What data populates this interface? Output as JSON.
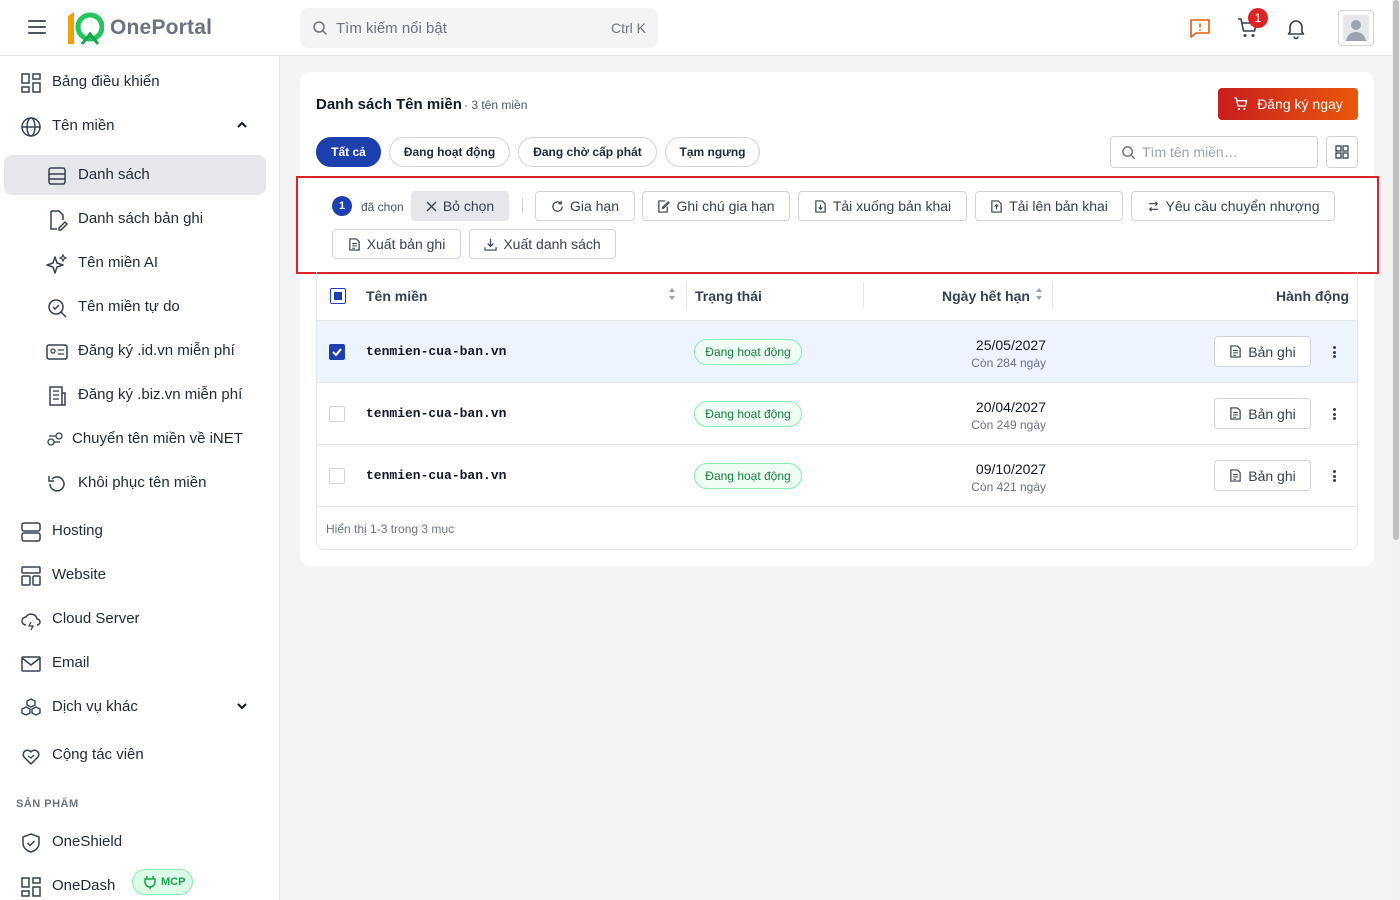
{
  "header": {
    "logo_text": "OnePortal",
    "search_placeholder": "Tìm kiếm nổi bật",
    "search_shortcut": "Ctrl K",
    "cart_count": "1"
  },
  "sidebar": {
    "items": [
      {
        "label": "Bảng điều khiển"
      },
      {
        "label": "Tên miền"
      },
      {
        "label": "Danh sách"
      },
      {
        "label": "Danh sách bản ghi"
      },
      {
        "label": "Tên miền AI"
      },
      {
        "label": "Tên miền tự do"
      },
      {
        "label": "Đăng ký .id.vn miễn phí"
      },
      {
        "label": "Đăng ký .biz.vn miễn phí"
      },
      {
        "label": "Chuyển tên miền về iNET"
      },
      {
        "label": "Khôi phục tên miền"
      },
      {
        "label": "Hosting"
      },
      {
        "label": "Website"
      },
      {
        "label": "Cloud Server"
      },
      {
        "label": "Email"
      },
      {
        "label": "Dịch vụ khác"
      },
      {
        "label": "Cộng tác viên"
      },
      {
        "label": "OneShield"
      },
      {
        "label": "OneDash"
      }
    ],
    "section_products": "SẢN PHẨM",
    "mcp_badge": "MCP"
  },
  "page": {
    "title": "Danh sách Tên miền",
    "count": "· 3 tên miền",
    "register_button": "Đăng ký ngay",
    "tabs": [
      {
        "label": "Tất cả"
      },
      {
        "label": "Đang hoạt động"
      },
      {
        "label": "Đang chờ cấp phát"
      },
      {
        "label": "Tạm ngưng"
      }
    ],
    "domain_search_placeholder": "Tìm tên miền…"
  },
  "action_bar": {
    "selected_count": "1",
    "selected_label": "đã chọn",
    "deselect": "Bỏ chọn",
    "actions": [
      {
        "label": "Gia hạn"
      },
      {
        "label": "Ghi chú gia hạn"
      },
      {
        "label": "Tải xuống bản khai"
      },
      {
        "label": "Tải lên bản khai"
      },
      {
        "label": "Yêu cầu chuyển nhượng"
      },
      {
        "label": "Xuất bản ghi"
      },
      {
        "label": "Xuất danh sách"
      }
    ]
  },
  "table": {
    "headers": {
      "domain": "Tên miền",
      "status": "Trạng thái",
      "expiry": "Ngày hết hạn",
      "actions": "Hành động"
    },
    "rows": [
      {
        "domain": "tenmien-cua-ban.vn",
        "status": "Đang hoạt động",
        "expiry": "25/05/2027",
        "remaining": "Còn 284 ngày",
        "record_button": "Bản ghi",
        "selected": true
      },
      {
        "domain": "tenmien-cua-ban.vn",
        "status": "Đang hoạt động",
        "expiry": "20/04/2027",
        "remaining": "Còn 249 ngày",
        "record_button": "Bản ghi",
        "selected": false
      },
      {
        "domain": "tenmien-cua-ban.vn",
        "status": "Đang hoạt động",
        "expiry": "09/10/2027",
        "remaining": "Còn 421 ngày",
        "record_button": "Bản ghi",
        "selected": false
      }
    ],
    "footer": "Hiển thị 1-3 trong 3 mục"
  },
  "colors": {
    "primary": "#1e40af",
    "accent": "#dc2626",
    "success": "#15803d"
  }
}
